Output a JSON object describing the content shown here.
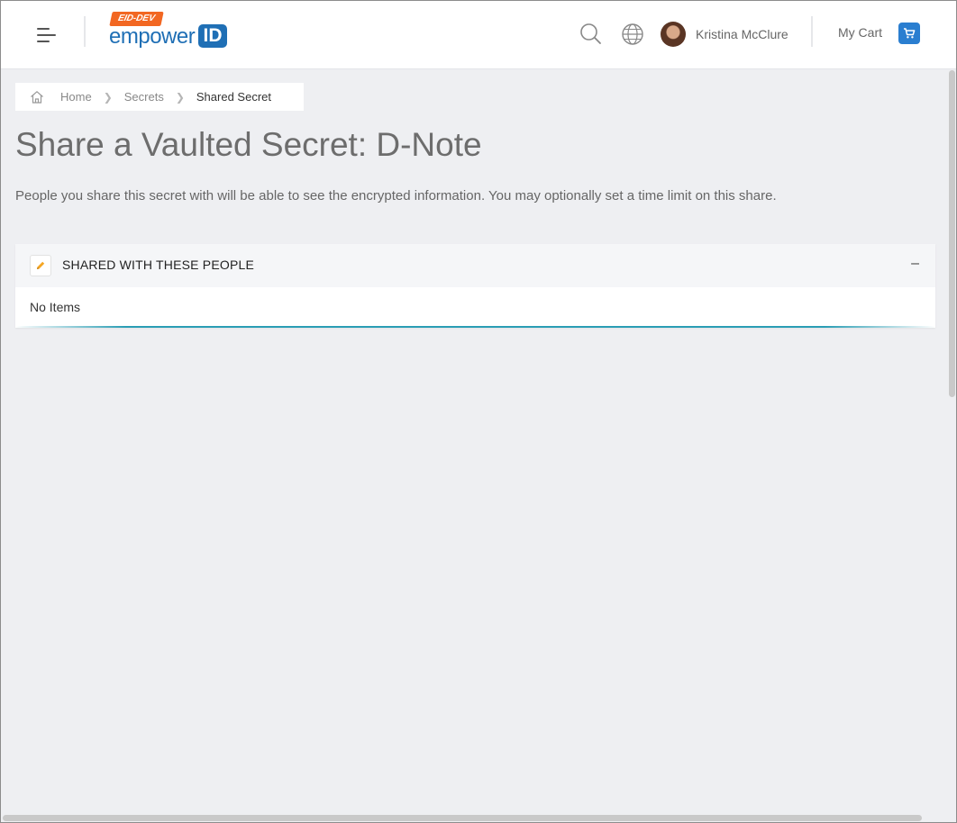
{
  "header": {
    "env_badge": "EID-DEV",
    "logo_word": "empower",
    "logo_id": "ID",
    "user_name": "Kristina McClure",
    "cart_label": "My Cart"
  },
  "breadcrumb": {
    "items": [
      {
        "label": "Home"
      },
      {
        "label": "Secrets"
      },
      {
        "label": "Shared Secret"
      }
    ]
  },
  "page": {
    "title": "Share a Vaulted Secret: D-Note",
    "description": "People you share this secret with will be able to see the encrypted information. You may optionally set a time limit on this share."
  },
  "panel": {
    "title": "SHARED WITH THESE PEOPLE",
    "collapse_symbol": "–",
    "empty_text": "No Items"
  },
  "colors": {
    "brand_blue": "#1f6fb5",
    "badge_orange": "#f26722",
    "cart_blue": "#2a7ed0",
    "panel_accent": "#2a9db4",
    "edit_icon": "#f5a623"
  },
  "icons": [
    "menu-icon",
    "search-icon",
    "globe-icon",
    "cart-icon",
    "home-icon",
    "pencil-icon"
  ]
}
